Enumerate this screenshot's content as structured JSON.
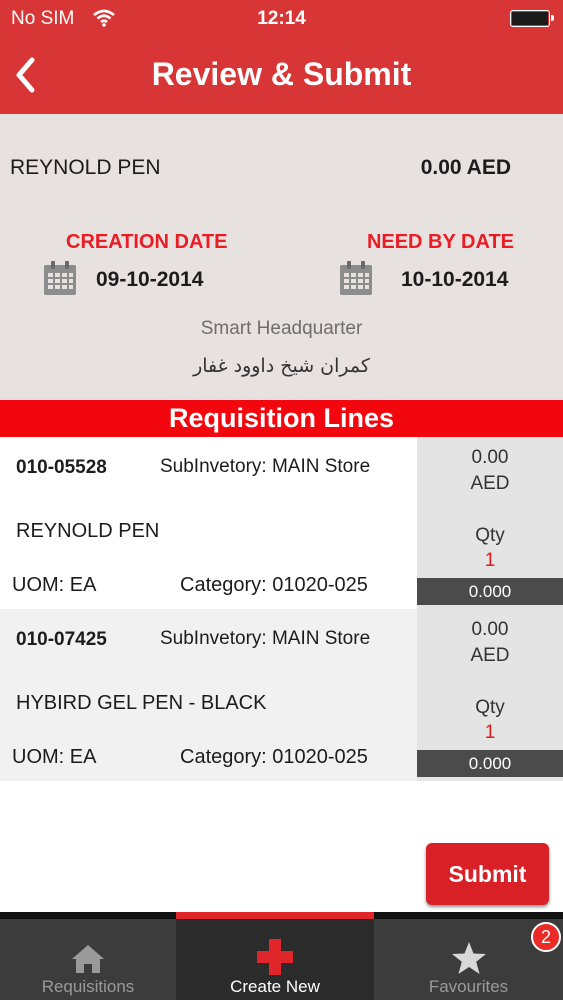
{
  "status": {
    "carrier": "No SIM",
    "time": "12:14"
  },
  "nav": {
    "title": "Review & Submit",
    "back_icon": "chevron-left-icon"
  },
  "summary": {
    "item_name": "REYNOLD PEN",
    "total": "0.00 AED",
    "creation_label": "CREATION DATE",
    "creation_date": "09-10-2014",
    "need_label": "NEED BY DATE",
    "need_date": "10-10-2014",
    "location": "Smart Headquarter",
    "requester": "كمران شيخ داوود غفار"
  },
  "lines_header": "Requisition Lines",
  "lines": [
    {
      "code": "010-05528",
      "subinventory": "SubInvetory: MAIN Store",
      "description": "REYNOLD PEN",
      "uom": "UOM: EA",
      "category": "Category: 01020-025",
      "price_value": "0.00",
      "price_currency": "AED",
      "qty_label": "Qty",
      "qty": "1",
      "line_total": "0.000"
    },
    {
      "code": "010-07425",
      "subinventory": "SubInvetory: MAIN Store",
      "description": "HYBIRD GEL PEN - BLACK",
      "uom": "UOM: EA",
      "category": "Category: 01020-025",
      "price_value": "0.00",
      "price_currency": "AED",
      "qty_label": "Qty",
      "qty": "1",
      "line_total": "0.000"
    }
  ],
  "submit_label": "Submit",
  "tabs": [
    {
      "label": "Requisitions",
      "icon": "home-icon"
    },
    {
      "label": "Create New",
      "icon": "plus-icon"
    },
    {
      "label": "Favourites",
      "icon": "star-icon",
      "badge": "2"
    }
  ],
  "colors": {
    "primary_red": "#d83636",
    "header_red": "#f2070e",
    "accent_red": "#ea1c24",
    "tab_bar": "#3c3c3c"
  }
}
